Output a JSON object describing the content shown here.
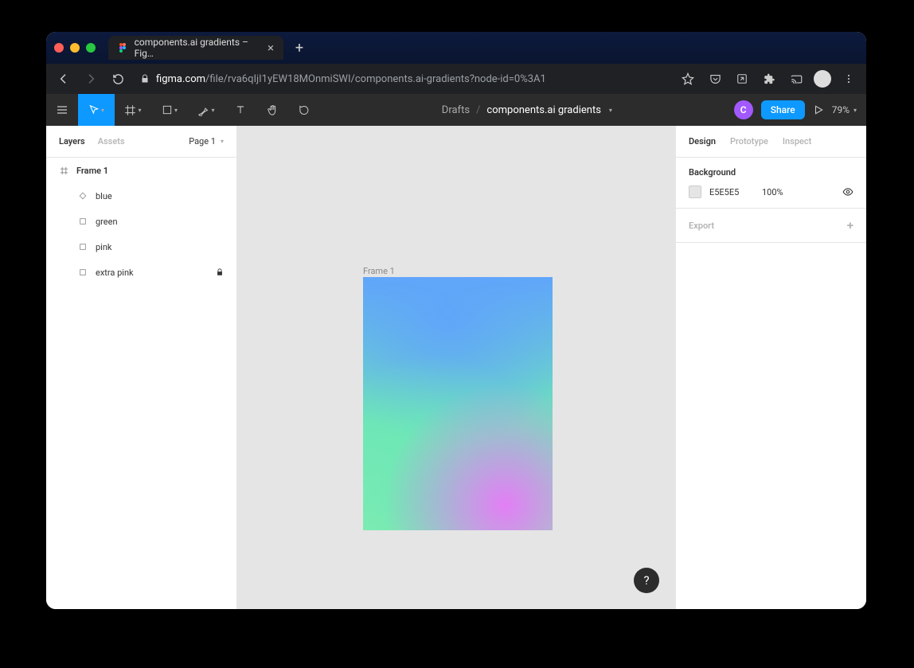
{
  "browser": {
    "tab_title": "components.ai gradients – Fig…",
    "url_host": "figma.com",
    "url_path": "/file/rva6qIjI1yEW18MOnmiSWI/components.ai-gradients?node-id=0%3A1"
  },
  "toolbar": {
    "breadcrumb_drafts": "Drafts",
    "breadcrumb_file": "components.ai gradients",
    "user_initial": "C",
    "share_label": "Share",
    "zoom": "79%"
  },
  "left_panel": {
    "tabs": {
      "layers": "Layers",
      "assets": "Assets"
    },
    "page": "Page 1",
    "layers": [
      {
        "name": "Frame 1",
        "kind": "frame"
      },
      {
        "name": "blue",
        "kind": "shape"
      },
      {
        "name": "green",
        "kind": "shape"
      },
      {
        "name": "pink",
        "kind": "shape"
      },
      {
        "name": "extra pink",
        "kind": "shape",
        "locked": true
      }
    ]
  },
  "canvas": {
    "frame_label": "Frame 1"
  },
  "right_panel": {
    "tabs": {
      "design": "Design",
      "prototype": "Prototype",
      "inspect": "Inspect"
    },
    "background_title": "Background",
    "bg_hex": "E5E5E5",
    "bg_opacity": "100%",
    "export_title": "Export"
  },
  "help": "?"
}
